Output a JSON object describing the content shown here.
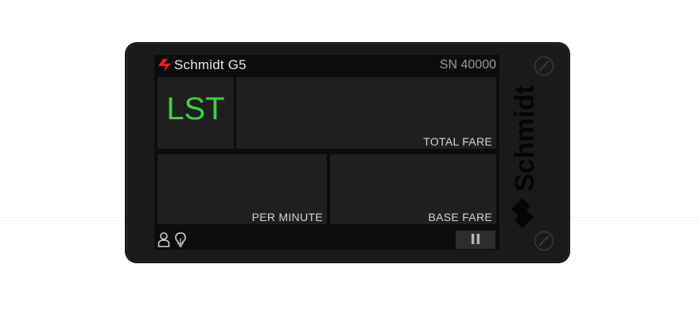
{
  "device": {
    "brand": "Schmidt G5",
    "serial": "SN 40000",
    "side_logo": "Schmidt"
  },
  "panels": {
    "tariff": {
      "value": "LST"
    },
    "total_fare": {
      "label": "TOTAL FARE",
      "value": ""
    },
    "per_minute": {
      "label": "PER MINUTE",
      "value": ""
    },
    "base_fare": {
      "label": "BASE FARE",
      "value": ""
    }
  },
  "bottombar": {
    "icons": [
      "user-icon",
      "lightbulb-icon"
    ],
    "pause_label": "II"
  },
  "colors": {
    "brand_red": "#e31e24",
    "status_green": "#3fd13f",
    "device_body": "#1a1a1a",
    "panel_bg": "#1f1f1f"
  }
}
